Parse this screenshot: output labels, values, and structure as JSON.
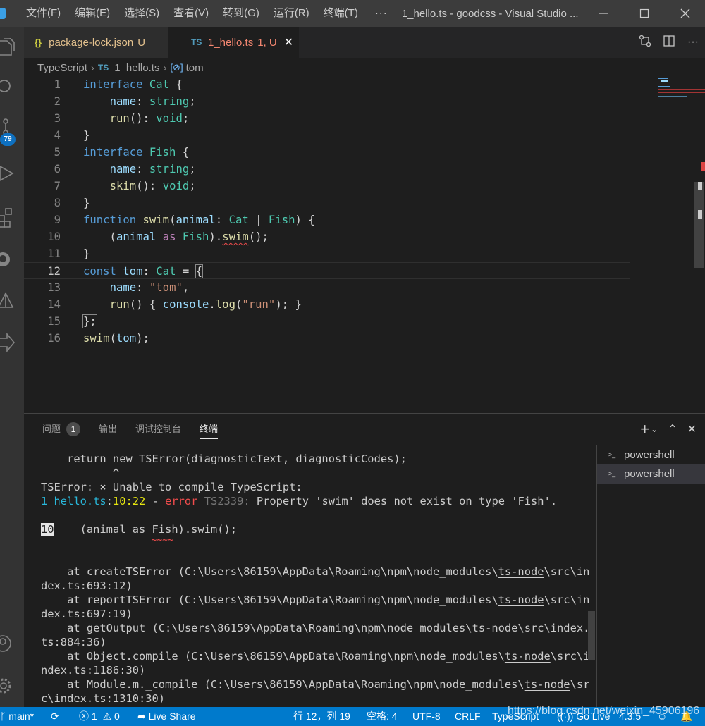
{
  "titlebar": {
    "menus": [
      "文件(F)",
      "编辑(E)",
      "选择(S)",
      "查看(V)",
      "转到(G)",
      "运行(R)",
      "终端(T)"
    ],
    "more": "···",
    "title": "1_hello.ts - goodcss - Visual Studio ..."
  },
  "activity": {
    "scm_badge": "79"
  },
  "tabs": {
    "tab1": {
      "icon": "{}",
      "label": "package-lock.json",
      "status": "U"
    },
    "tab2": {
      "icon": "TS",
      "label": "1_hello.ts",
      "status": "1, U"
    }
  },
  "breadcrumb": {
    "lang": "TypeScript",
    "file_icon": "TS",
    "file": "1_hello.ts",
    "symbol": "tom"
  },
  "editor": {
    "line_numbers": [
      "1",
      "2",
      "3",
      "4",
      "5",
      "6",
      "7",
      "8",
      "9",
      "10",
      "11",
      "12",
      "13",
      "14",
      "15",
      "16"
    ],
    "current_line": 12,
    "code": {
      "l1": {
        "kw": "interface",
        "ty": "Cat",
        "p": " {"
      },
      "l2": {
        "va": "name",
        "ty": "string"
      },
      "l3": {
        "fn": "run",
        "ty": "void"
      },
      "l4": "}",
      "l5": {
        "kw": "interface",
        "ty": "Fish",
        "p": " {"
      },
      "l6": {
        "va": "name",
        "ty": "string"
      },
      "l7": {
        "fn": "skim",
        "ty": "void"
      },
      "l8": "}",
      "l9": {
        "kw": "function",
        "fn": "swim",
        "va": "animal",
        "ty1": "Cat",
        "ty2": "Fish"
      },
      "l10": {
        "va": "animal",
        "kw": "as",
        "ty": "Fish",
        "fn": "swim"
      },
      "l11": "}",
      "l12": {
        "kw": "const",
        "va": "tom",
        "ty": "Cat"
      },
      "l13": {
        "va": "name",
        "st": "\"tom\""
      },
      "l14": {
        "fn": "run",
        "va": "console",
        "fn2": "log",
        "st": "\"run\""
      },
      "l15": "};",
      "l16": {
        "fn": "swim",
        "va": "tom"
      }
    }
  },
  "panel": {
    "tabs": [
      "问题",
      "输出",
      "调试控制台",
      "终端"
    ],
    "problems_count": "1",
    "actions": [
      "+",
      "⌄",
      "⌃",
      "✕"
    ],
    "terminals": [
      "powershell",
      "powershell"
    ]
  },
  "terminal": {
    "t1": "    return new TSError(diagnosticText, diagnosticCodes);",
    "t2": "           ^",
    "t3": "TSError: ⨯ Unable to compile TypeScript:",
    "t4_file": "1_hello.ts",
    "t4_pos": "10:22",
    "t4_sep": " - ",
    "t4_err": "error",
    "t4_code": "TS2339:",
    "t4_msg": " Property 'swim' does not exist on type 'Fish'.",
    "t6_num": "10",
    "t6_code": "    (animal as Fish).swim();",
    "t7": "                    ~~~~",
    "stack": [
      {
        "a": "    at createTSError (C:\\Users\\86159\\AppData\\Roaming\\npm\\node_modules\\",
        "u": "ts-node",
        "b": "\\src\\in"
      },
      {
        "a": "dex.ts:693:12)",
        "u": "",
        "b": ""
      },
      {
        "a": "    at reportTSError (C:\\Users\\86159\\AppData\\Roaming\\npm\\node_modules\\",
        "u": "ts-node",
        "b": "\\src\\in"
      },
      {
        "a": "dex.ts:697:19)",
        "u": "",
        "b": ""
      },
      {
        "a": "    at getOutput (C:\\Users\\86159\\AppData\\Roaming\\npm\\node_modules\\",
        "u": "ts-node",
        "b": "\\src\\index."
      },
      {
        "a": "ts:884:36)",
        "u": "",
        "b": ""
      },
      {
        "a": "    at Object.compile (C:\\Users\\86159\\AppData\\Roaming\\npm\\node_modules\\",
        "u": "ts-node",
        "b": "\\src\\i"
      },
      {
        "a": "ndex.ts:1186:30)",
        "u": "",
        "b": ""
      },
      {
        "a": "    at Module.m._compile (C:\\Users\\86159\\AppData\\Roaming\\npm\\node_modules\\",
        "u": "ts-node",
        "b": "\\sr"
      },
      {
        "a": "c\\index.ts:1310:30)",
        "u": "",
        "b": ""
      }
    ]
  },
  "statusbar": {
    "branch": "main*",
    "errors": "1",
    "warnings": "0",
    "live_share": "Live Share",
    "position": "行 12，列 19",
    "spaces": "空格: 4",
    "encoding": "UTF-8",
    "eol": "CRLF",
    "language": "TypeScript",
    "go_live": "Go Live",
    "version": "4.3.5"
  },
  "watermark": "https://blog.csdn.net/weixin_45906196",
  "colors": {
    "accent": "#007acc",
    "error": "#f14c4c",
    "keyword": "#569cd6",
    "type": "#4ec9b0"
  }
}
